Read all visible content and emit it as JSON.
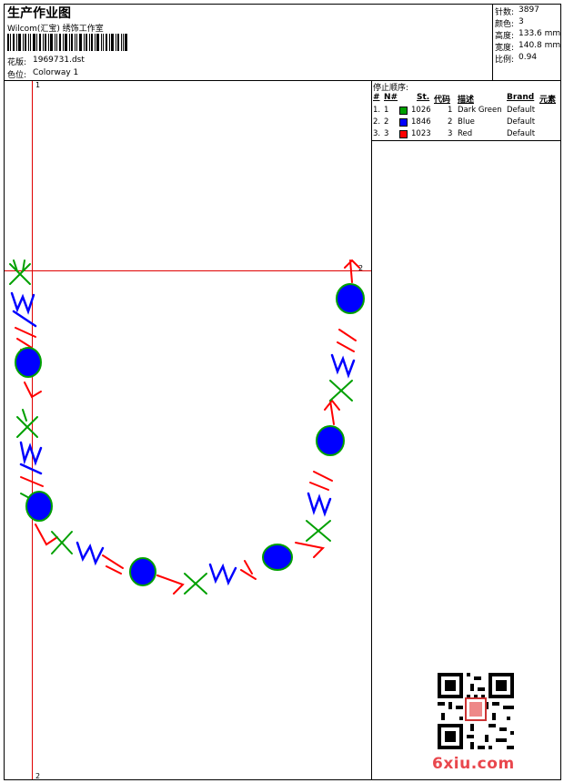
{
  "header": {
    "title": "生产作业图",
    "company": "Wilcom(汇宝) 绣饰工作室",
    "design_label": "花版:",
    "design_value": "1969731.dst",
    "colorway_label": "色位:",
    "colorway_value": "Colorway 1"
  },
  "stats": [
    {
      "label": "针数:",
      "value": "3897"
    },
    {
      "label": "颜色:",
      "value": "3"
    },
    {
      "label": "高度:",
      "value": "133.6 mm"
    },
    {
      "label": "宽度:",
      "value": "140.8 mm"
    },
    {
      "label": "比例:",
      "value": "0.94"
    }
  ],
  "sequence": {
    "title": "停止顺序:",
    "headers": [
      "#",
      "N#",
      "St.",
      "代码",
      "描述",
      "Brand",
      "元素"
    ],
    "rows": [
      {
        "index": "1.",
        "n": "1",
        "color": "#00a000",
        "st": "1026",
        "code": "1",
        "desc": "Dark Green",
        "brand": "Default"
      },
      {
        "index": "2.",
        "n": "2",
        "color": "#0000ff",
        "st": "1846",
        "code": "2",
        "desc": "Blue",
        "brand": "Default"
      },
      {
        "index": "3.",
        "n": "3",
        "color": "#ff0000",
        "st": "1023",
        "code": "3",
        "desc": "Red",
        "brand": "Default"
      }
    ]
  },
  "canvas": {
    "marker_1": "1",
    "marker_2": "2",
    "marker_bottom": "2"
  },
  "colors": {
    "green": "#00a000",
    "blue": "#0000ff",
    "red": "#ff0000",
    "guide": "#e00000"
  },
  "watermark": {
    "text": "6xiu.com"
  }
}
